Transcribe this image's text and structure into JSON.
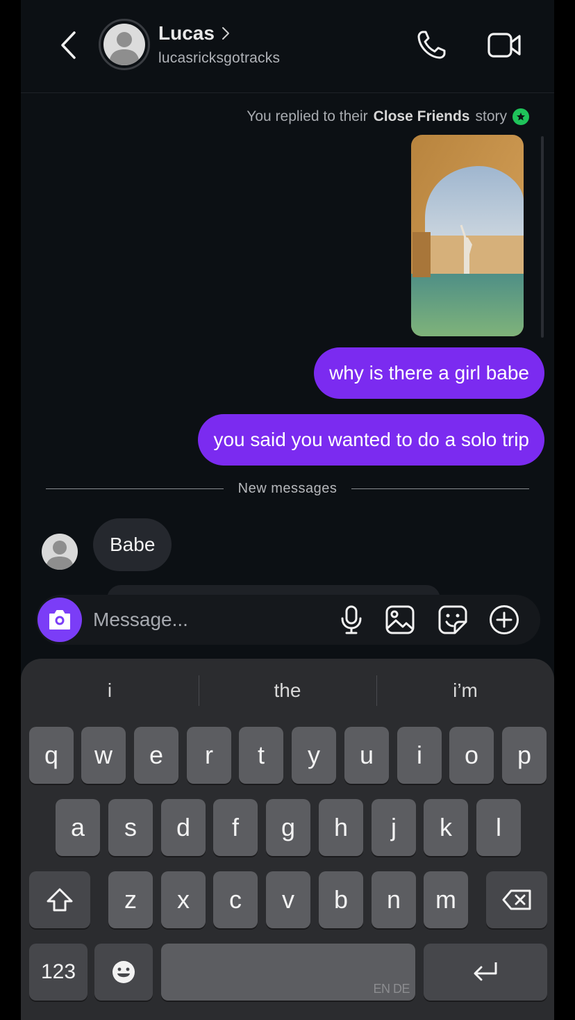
{
  "header": {
    "contact_name": "Lucas",
    "username": "lucasricksgotracks",
    "icons": [
      "back-chevron-icon",
      "chevron-right-icon",
      "phone-icon",
      "video-camera-icon"
    ]
  },
  "chat": {
    "reply_note_prefix": "You replied to their",
    "reply_note_bold": "Close Friends",
    "reply_note_suffix": "story",
    "outgoing": [
      "why is there a girl babe",
      "you said you wanted to do a solo trip"
    ],
    "divider_label": "New messages",
    "incoming": [
      "Babe"
    ]
  },
  "composer": {
    "placeholder": "Message...",
    "icons": [
      "camera-icon",
      "microphone-icon",
      "gallery-icon",
      "sticker-icon",
      "plus-icon"
    ]
  },
  "keyboard": {
    "suggestions": [
      "i",
      "the",
      "i’m"
    ],
    "row1": [
      "q",
      "w",
      "e",
      "r",
      "t",
      "y",
      "u",
      "i",
      "o",
      "p"
    ],
    "row2": [
      "a",
      "s",
      "d",
      "f",
      "g",
      "h",
      "j",
      "k",
      "l"
    ],
    "row3": [
      "z",
      "x",
      "c",
      "v",
      "b",
      "n",
      "m"
    ],
    "numbers_key": "123",
    "space_hint": "EN DE"
  },
  "colors": {
    "background": "#0c1014",
    "outgoing_bubble": "#7b2bf0",
    "incoming_bubble": "#25282e",
    "camera_button": "#7b3df7",
    "close_friends_badge": "#1fc35a",
    "keyboard_bg": "#2b2c2f",
    "key_bg": "#5c5d61"
  }
}
